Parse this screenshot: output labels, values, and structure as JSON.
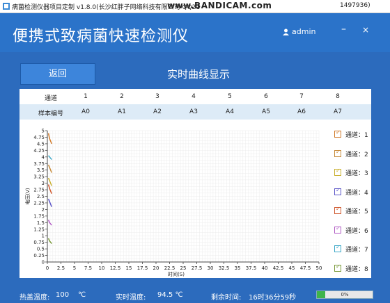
{
  "window": {
    "title": "病菌检测仪器项目定制 v1.8.0(长沙红胖子网络科技有限公司 QQ21",
    "title_tail": "1497936)",
    "watermark": "www.BANDICAM.com"
  },
  "header": {
    "app_title": "便携式致病菌快速检测仪",
    "user": "admin",
    "minimize": "–",
    "close": "×"
  },
  "toolbar": {
    "back_label": "返回",
    "page_title": "实时曲线显示"
  },
  "table": {
    "row1_label": "通道",
    "row2_label": "样本编号",
    "channels": [
      "1",
      "2",
      "3",
      "4",
      "5",
      "6",
      "7",
      "8"
    ],
    "samples": [
      "A0",
      "A1",
      "A2",
      "A3",
      "A4",
      "A5",
      "A6",
      "A7"
    ]
  },
  "legend": {
    "items": [
      {
        "label": "通道：1",
        "color": "#d07a2a"
      },
      {
        "label": "通道：2",
        "color": "#c68a3a"
      },
      {
        "label": "通道：3",
        "color": "#c9b030"
      },
      {
        "label": "通道：4",
        "color": "#5d57c8"
      },
      {
        "label": "通道：5",
        "color": "#d05a30"
      },
      {
        "label": "通道：6",
        "color": "#b15ac4"
      },
      {
        "label": "通道：7",
        "color": "#3ba7c7"
      },
      {
        "label": "通道：8",
        "color": "#7a9a3a"
      }
    ]
  },
  "chart_data": {
    "type": "line",
    "xlabel": "时间(S)",
    "ylabel": "电压(V)",
    "xlim": [
      0,
      50
    ],
    "ylim": [
      0,
      5
    ],
    "x_ticks": [
      "0",
      "2.5",
      "5",
      "7.5",
      "10",
      "12.5",
      "15",
      "17.5",
      "20",
      "22.5",
      "25",
      "27.5",
      "30",
      "32.5",
      "35",
      "37.5",
      "40",
      "42.5",
      "45",
      "47.5",
      "50"
    ],
    "y_ticks": [
      "0",
      "0.25",
      "0.5",
      "0.75",
      "1",
      "1.25",
      "1.5",
      "1.75",
      "2",
      "2.25",
      "2.5",
      "2.75",
      "3",
      "3.25",
      "3.5",
      "3.75",
      "4",
      "4.25",
      "4.5",
      "4.75",
      "5"
    ],
    "grid": true,
    "series": [
      {
        "name": "通道：1",
        "color": "#d07a2a",
        "x": [
          0.2,
          0.4,
          0.6,
          0.8
        ],
        "y": [
          4.9,
          4.7,
          4.6,
          4.5
        ]
      },
      {
        "name": "通道：2",
        "color": "#c68a3a",
        "x": [
          0.2,
          0.4,
          0.6,
          0.8
        ],
        "y": [
          3.7,
          3.6,
          3.5,
          3.4
        ]
      },
      {
        "name": "通道：3",
        "color": "#c9b030",
        "x": [
          0.2,
          0.4,
          0.6,
          0.8
        ],
        "y": [
          3.2,
          3.1,
          3.0,
          2.9
        ]
      },
      {
        "name": "通道：4",
        "color": "#5d57c8",
        "x": [
          0.2,
          0.4,
          0.6,
          0.8
        ],
        "y": [
          2.4,
          2.3,
          2.2,
          2.1
        ]
      },
      {
        "name": "通道：5",
        "color": "#d05a30",
        "x": [
          0.2,
          0.4,
          0.6,
          0.8
        ],
        "y": [
          2.95,
          2.8,
          2.7,
          2.6
        ]
      },
      {
        "name": "通道：6",
        "color": "#b15ac4",
        "x": [
          0.2,
          0.4,
          0.6,
          0.8
        ],
        "y": [
          1.6,
          1.5,
          1.45,
          1.4
        ]
      },
      {
        "name": "通道：7",
        "color": "#3ba7c7",
        "x": [
          0.2,
          0.4,
          0.6,
          0.8
        ],
        "y": [
          4.05,
          4.0,
          3.95,
          3.9
        ]
      },
      {
        "name": "通道：8",
        "color": "#7a9a3a",
        "x": [
          0.2,
          0.4,
          0.6,
          0.8
        ],
        "y": [
          0.9,
          0.8,
          0.75,
          0.7
        ]
      }
    ]
  },
  "status": {
    "heat_label": "热盖温度:",
    "heat_value": "100",
    "heat_unit": "℃",
    "real_label": "实时温度:",
    "real_value": "94.5 ℃",
    "remain_label": "剩余时间:",
    "remain_value": "16时36分59秒",
    "progress_text": "0%",
    "progress": 0.15
  }
}
